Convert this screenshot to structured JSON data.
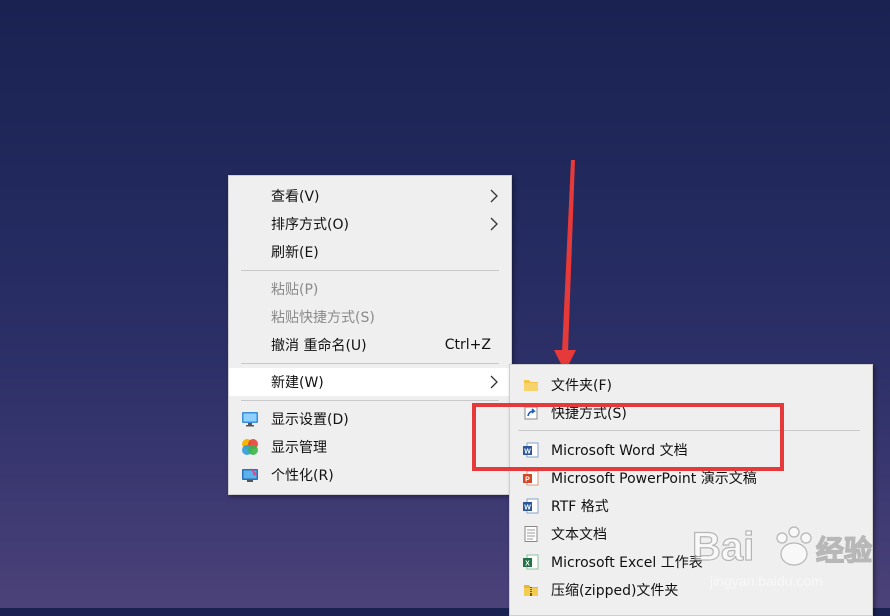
{
  "context_menu": {
    "items": [
      {
        "label": "查看(V)",
        "has_submenu": true
      },
      {
        "label": "排序方式(O)",
        "has_submenu": true
      },
      {
        "label": "刷新(E)"
      },
      {
        "label": "粘贴(P)",
        "disabled": true
      },
      {
        "label": "粘贴快捷方式(S)",
        "disabled": true
      },
      {
        "label": "撤消 重命名(U)",
        "shortcut": "Ctrl+Z"
      },
      {
        "label": "新建(W)",
        "has_submenu": true,
        "highlighted": true
      },
      {
        "label": "显示设置(D)",
        "icon": "display-settings-icon"
      },
      {
        "label": "显示管理",
        "icon": "display-manager-icon"
      },
      {
        "label": "个性化(R)",
        "icon": "personalize-icon"
      }
    ]
  },
  "new_submenu": {
    "items": [
      {
        "label": "文件夹(F)",
        "icon": "folder-icon"
      },
      {
        "label": "快捷方式(S)",
        "icon": "shortcut-icon"
      },
      {
        "label": "Microsoft Word 文档",
        "icon": "word-doc-icon"
      },
      {
        "label": "Microsoft PowerPoint 演示文稿",
        "icon": "powerpoint-icon"
      },
      {
        "label": "RTF 格式",
        "icon": "rtf-icon"
      },
      {
        "label": "文本文档",
        "icon": "text-doc-icon"
      },
      {
        "label": "Microsoft Excel 工作表",
        "icon": "excel-icon"
      },
      {
        "label": "压缩(zipped)文件夹",
        "icon": "zip-folder-icon"
      }
    ]
  },
  "watermark": {
    "brand": "Bai 经验",
    "url": "jingyan.baidu.com"
  },
  "colors": {
    "annotation_red": "#e63a3a",
    "menu_bg": "#efefef",
    "highlight": "#ffffff"
  }
}
